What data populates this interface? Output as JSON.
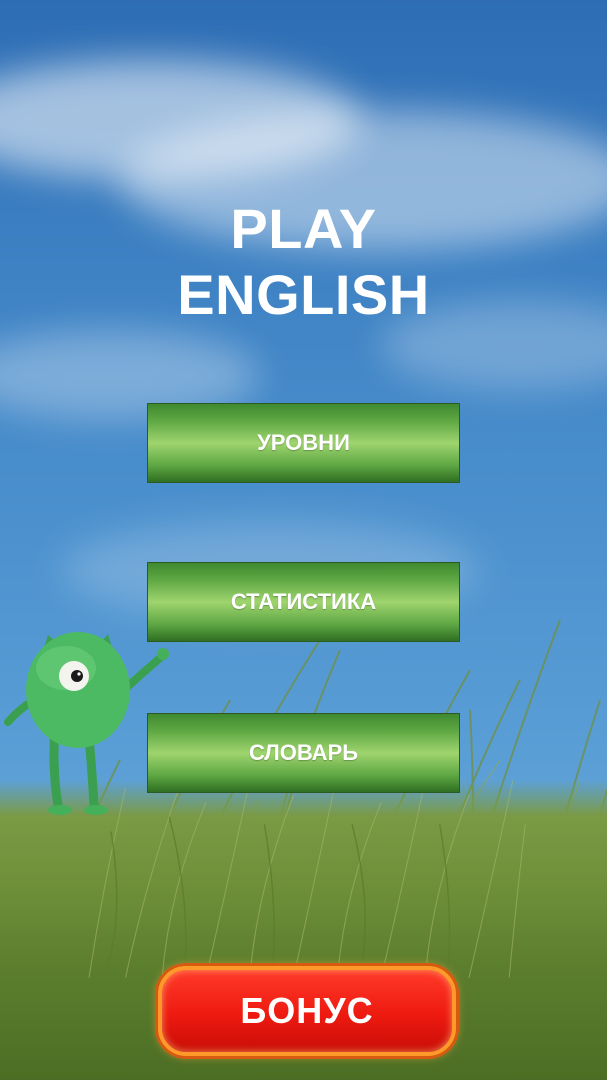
{
  "title": {
    "line1": "PLAY",
    "line2": "ENGLISH"
  },
  "menu": {
    "levels": "УРОВНИ",
    "statistics": "СТАТИСТИКА",
    "dictionary": "СЛОВАРЬ"
  },
  "bonus": {
    "label": "БОНУС"
  },
  "colors": {
    "sky": "#3e82c4",
    "menu_button": "#5fa844",
    "bonus_button": "#ee1a10",
    "bonus_border": "#ff9a2a",
    "grass": "#6f8f3a"
  },
  "icons": {
    "mascot": "one-eyed-green-monster"
  }
}
